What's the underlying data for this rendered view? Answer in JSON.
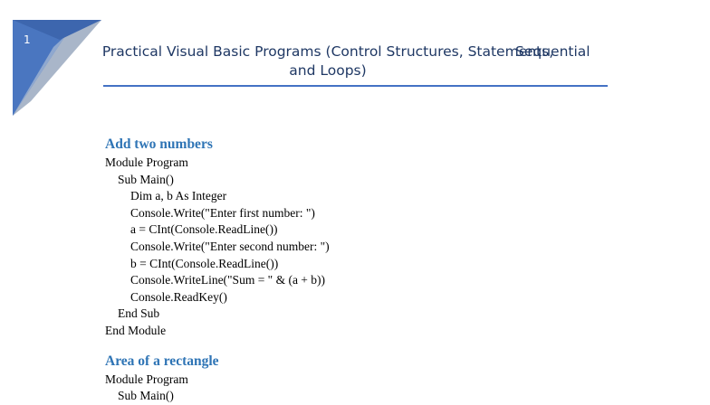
{
  "page": {
    "number": "1",
    "header_title": "Practical Visual Basic Programs (Control Structures, Statements, and Loops)",
    "header_right": "Sequential"
  },
  "sections": [
    {
      "heading": "Add two numbers",
      "lines": [
        {
          "text": "Module Program",
          "indent": 0
        },
        {
          "text": "Sub Main()",
          "indent": 1
        },
        {
          "text": "Dim a, b As Integer",
          "indent": 2
        },
        {
          "text": "Console.Write(\"Enter first number: \")",
          "indent": 2
        },
        {
          "text": "a = CInt(Console.ReadLine())",
          "indent": 2
        },
        {
          "text": "Console.Write(\"Enter second number: \")",
          "indent": 2
        },
        {
          "text": "b = CInt(Console.ReadLine())",
          "indent": 2
        },
        {
          "text": "Console.WriteLine(\"Sum = \" & (a + b))",
          "indent": 2
        },
        {
          "text": "Console.ReadKey()",
          "indent": 2
        },
        {
          "text": "End Sub",
          "indent": 1
        },
        {
          "text": "End Module",
          "indent": 0
        }
      ]
    },
    {
      "heading": "Area of a rectangle",
      "lines": [
        {
          "text": "Module Program",
          "indent": 0
        },
        {
          "text": "Sub Main()",
          "indent": 1
        }
      ]
    }
  ],
  "colors": {
    "accent": "#4472c4",
    "heading": "#2e74b5",
    "corner_dark": "#4472c4",
    "corner_light": "#a5b4cc"
  }
}
